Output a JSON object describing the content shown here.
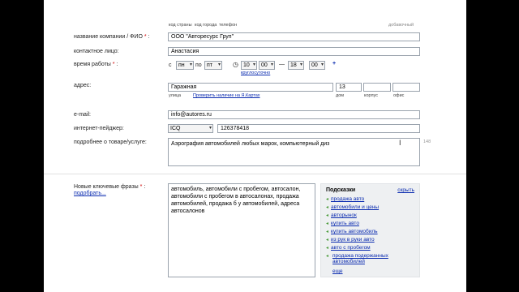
{
  "header": {
    "code_country": "код страны",
    "code_city": "код города",
    "phone": "телефон",
    "additional": "добавочный"
  },
  "form": {
    "company_label": "название компании / ФИО",
    "company_value": "ООО \"Авторесурс Груп\"",
    "contact_label": "контактное лицо:",
    "contact_value": "Анастасия",
    "hours_label": "время работы",
    "from": "с",
    "day_from": "пн",
    "to": "по",
    "day_to": "пт",
    "hour_from": "10",
    "min_from": "00",
    "dash": "—",
    "hour_to": "18",
    "min_to": "00",
    "plus": "+",
    "allday_link": "круглосуточно",
    "address_label": "адрес:",
    "street_value": "Гаражная",
    "house_value": "13",
    "street_sub": "улица",
    "map_link": "Проверить наличие на Я.Картах",
    "house_sub": "дом",
    "corp_sub": "корпус",
    "office_sub": "офис",
    "email_label": "e-mail:",
    "email_value": "info@autores.ru",
    "pager_label": "интернет-пейджер:",
    "pager_type": "ICQ",
    "pager_value": "126378418",
    "details_label": "подробнее о товаре/услуге:",
    "details_value": "Аэрография автомобилей любых марок, компьютерный диз",
    "details_counter": "148",
    "keywords_label": "Новые ключевые фразы",
    "keywords_link": "подобрать...",
    "keywords_value": "автомобиль, автомобили с пробегом, автосалон, автомобили с пробегом в автосалонах, продажа автомобилей, продажа б у автомобилей, адреса автосалонов"
  },
  "hints": {
    "title": "Подсказки",
    "hide_link": "скрыть",
    "items": [
      "продажа авто",
      "автомобили и цены",
      "авторынок",
      "купить авто",
      "купить автомобиль",
      "из рук в руки авто",
      "авто с пробегом",
      "продажа подержанных автомобилей"
    ],
    "more_link": "еще"
  }
}
